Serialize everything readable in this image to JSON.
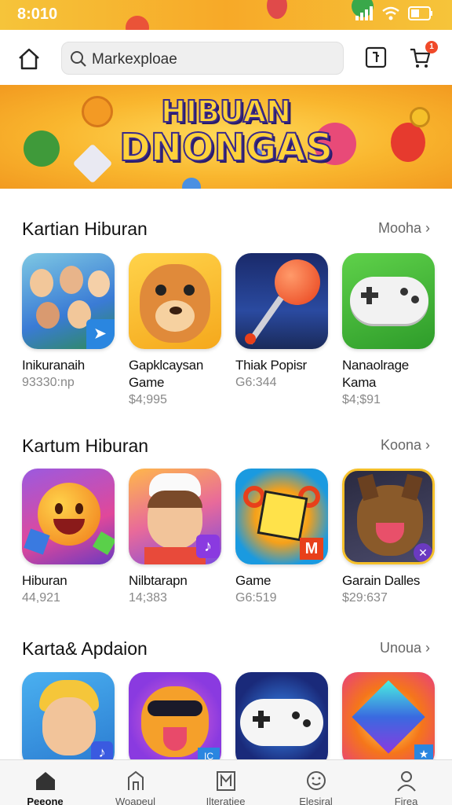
{
  "status": {
    "time": "8:010"
  },
  "search": {
    "placeholder": "Markexploae"
  },
  "header": {
    "cart_badge": "1"
  },
  "banner": {
    "line1": "HIBUAN",
    "line2": "DNONGAS"
  },
  "sections": [
    {
      "title": "Kartian Hiburan",
      "more": "Mooha",
      "apps": [
        {
          "name": "Inikuranaih",
          "meta": "93330:np",
          "icon": "crowd-people-icon"
        },
        {
          "name": "Gapklcaysan Game",
          "meta": "$4;995",
          "icon": "hamster-icon"
        },
        {
          "name": "Thiak Popisr",
          "meta": "G6:344",
          "icon": "pin-ball-icon"
        },
        {
          "name": "Nanaolrage Kama",
          "meta": "$4;$91",
          "icon": "gamepad-icon"
        }
      ]
    },
    {
      "title": "Kartum Hiburan",
      "more": "Koona",
      "apps": [
        {
          "name": "Hiburan",
          "meta": "44,921",
          "icon": "smiley-ball-icon"
        },
        {
          "name": "Nilbtarapn",
          "meta": "14;383",
          "icon": "chef-boy-icon"
        },
        {
          "name": "Game",
          "meta": "G6:519",
          "icon": "cube-character-icon"
        },
        {
          "name": "Garain Dalles",
          "meta": "$29:637",
          "icon": "wolf-dog-icon"
        }
      ]
    },
    {
      "title": "Karta& Apdaion",
      "more": "Unoua",
      "apps": [
        {
          "name": "",
          "meta": "",
          "icon": "blond-boy-icon"
        },
        {
          "name": "",
          "meta": "",
          "icon": "cat-sunglasses-icon"
        },
        {
          "name": "",
          "meta": "",
          "icon": "controller-icon"
        },
        {
          "name": "",
          "meta": "",
          "icon": "gem-icon"
        }
      ]
    }
  ],
  "tabs": [
    {
      "label": "Peeone",
      "icon": "home-icon",
      "active": true
    },
    {
      "label": "Woapeul",
      "icon": "building-icon",
      "active": false
    },
    {
      "label": "Ilteratiee",
      "icon": "book-icon",
      "active": false
    },
    {
      "label": "Elesiral",
      "icon": "smile-icon",
      "active": false
    },
    {
      "label": "Firea",
      "icon": "profile-icon",
      "active": false
    }
  ],
  "colors": {
    "accent": "#f7a928",
    "badge": "#f04a2a",
    "muted": "#888888"
  }
}
